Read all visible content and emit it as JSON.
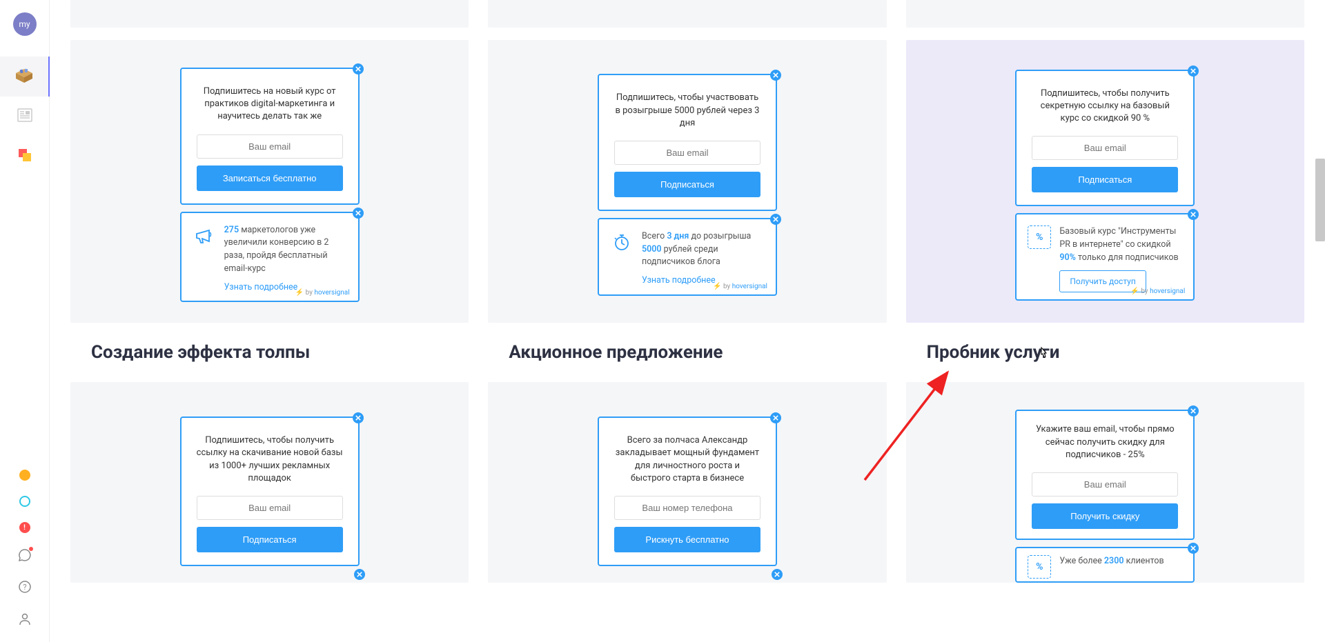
{
  "sidebar": {
    "avatar_label": "my"
  },
  "titles": {
    "crowd": "Создание эффекта толпы",
    "promo": "Акционное предложение",
    "trial": "Пробник услуги"
  },
  "cards": {
    "crowd": {
      "popup_headline": "Подпишитесь на новый курс от практиков digital-маркетинга и научитесь делать так же",
      "email_placeholder": "Ваш email",
      "cta": "Записаться бесплатно",
      "notif_count": "275",
      "notif_text_before": "маркетологов уже увеличили конверсию в 2 раза, пройдя бесплатный email-курс",
      "notif_link": "Узнать подробнее"
    },
    "promo": {
      "popup_headline": "Подпишитесь, чтобы участвовать в розыгрыше 5000 рублей через 3 дня",
      "email_placeholder": "Ваш email",
      "cta": "Подписаться",
      "notif_pre": "Всего",
      "notif_days": "3 дня",
      "notif_mid": "до розыгрыша",
      "notif_amount": "5000",
      "notif_post": "рублей среди подписчиков блога",
      "notif_link": "Узнать подробнее"
    },
    "trial": {
      "popup_headline": "Подпишитесь, чтобы получить секретную ссылку на базовый курс со скидкой 90 %",
      "email_placeholder": "Ваш email",
      "cta": "Подписаться",
      "notif_text_before": "Базовый курс \"Инструменты PR в интернете\" со скидкой",
      "notif_percent": "90%",
      "notif_text_after": "только для подписчиков",
      "notif_btn": "Получить доступ"
    },
    "row2_left": {
      "popup_headline": "Подпишитесь, чтобы получить ссылку на скачивание новой базы из 1000+ лучших рекламных площадок",
      "email_placeholder": "Ваш email",
      "cta": "Подписаться"
    },
    "row2_mid": {
      "popup_headline": "Всего за полчаса Александр закладывает мощный фундамент для личностного роста и быстрого старта в бизнесе",
      "phone_placeholder": "Ваш номер телефона",
      "cta": "Рискнуть бесплатно"
    },
    "row2_right": {
      "popup_headline": "Укажите ваш email, чтобы прямо сейчас получить скидку для подписчиков - 25%",
      "email_placeholder": "Ваш email",
      "cta": "Получить скидку",
      "notif_pre": "Уже более",
      "notif_count": "2300",
      "notif_post": "клиентов"
    }
  },
  "brand": {
    "by": "by",
    "name": "hoversignal"
  }
}
